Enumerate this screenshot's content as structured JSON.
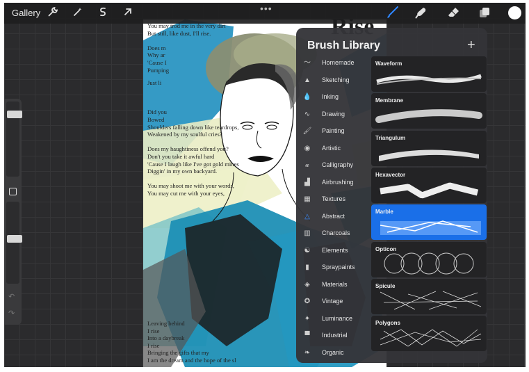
{
  "topbar": {
    "gallery": "Gallery",
    "tools_left": [
      "wrench-icon",
      "magic-wand-icon",
      "selection-icon",
      "transform-arrow-icon"
    ],
    "tools_right": [
      "brush-icon",
      "smudge-icon",
      "eraser-icon",
      "layers-icon"
    ],
    "more": "•••",
    "active_color": "#ffffff"
  },
  "sidebar": {
    "brush_size_level": 0.13,
    "opacity_level": 0.55
  },
  "artwork": {
    "poem_top": "You may trod me in the very dirt\nBut still, like dust, I'll rise.\n\nDoes m\nWhy ar\n'Cause I\nPumping",
    "poem_mid": "Just li\n\n\n\nDid you\nBowed\nShoulders falling down like teardrops,\nWeakened by my soulful cries?\n\nDoes my haughtiness offend you?\nDon't you take it awful hard\n'Cause I laugh like I've got gold mines\nDiggin' in my own backyard.\n\nYou may shoot me with your words,\nYou may cut me with your eyes,",
    "poem_bottom": "Leaving behind\nI rise\nInto a daybreak\nI rise\nBringing the gifts that my\nI am the dream and the hope of the sl",
    "title_fragment": "Rise"
  },
  "brush_library": {
    "title": "Brush Library",
    "add_label": "+",
    "sets": [
      {
        "label": "Homemade",
        "icon": "homemade-stroke-icon"
      },
      {
        "label": "Sketching",
        "icon": "pencil-tip-icon"
      },
      {
        "label": "Inking",
        "icon": "ink-drop-icon"
      },
      {
        "label": "Drawing",
        "icon": "squiggle-icon"
      },
      {
        "label": "Painting",
        "icon": "paintbrush-icon"
      },
      {
        "label": "Artistic",
        "icon": "palette-icon"
      },
      {
        "label": "Calligraphy",
        "icon": "calligraphy-a-icon"
      },
      {
        "label": "Airbrushing",
        "icon": "airbrush-icon"
      },
      {
        "label": "Textures",
        "icon": "texture-grid-icon"
      },
      {
        "label": "Abstract",
        "icon": "triangle-icon",
        "active": true
      },
      {
        "label": "Charcoals",
        "icon": "charcoal-bars-icon"
      },
      {
        "label": "Elements",
        "icon": "yin-yang-icon"
      },
      {
        "label": "Spraypaints",
        "icon": "spray-can-icon"
      },
      {
        "label": "Materials",
        "icon": "cube-icon"
      },
      {
        "label": "Vintage",
        "icon": "star-badge-icon"
      },
      {
        "label": "Luminance",
        "icon": "sparkle-icon"
      },
      {
        "label": "Industrial",
        "icon": "anvil-icon"
      },
      {
        "label": "Organic",
        "icon": "leaf-icon"
      }
    ],
    "brushes": [
      {
        "name": "Waveform"
      },
      {
        "name": "Membrane"
      },
      {
        "name": "Triangulum"
      },
      {
        "name": "Hexavector"
      },
      {
        "name": "Marble",
        "selected": true
      },
      {
        "name": "Opticon"
      },
      {
        "name": "Spicule"
      },
      {
        "name": "Polygons"
      }
    ]
  }
}
